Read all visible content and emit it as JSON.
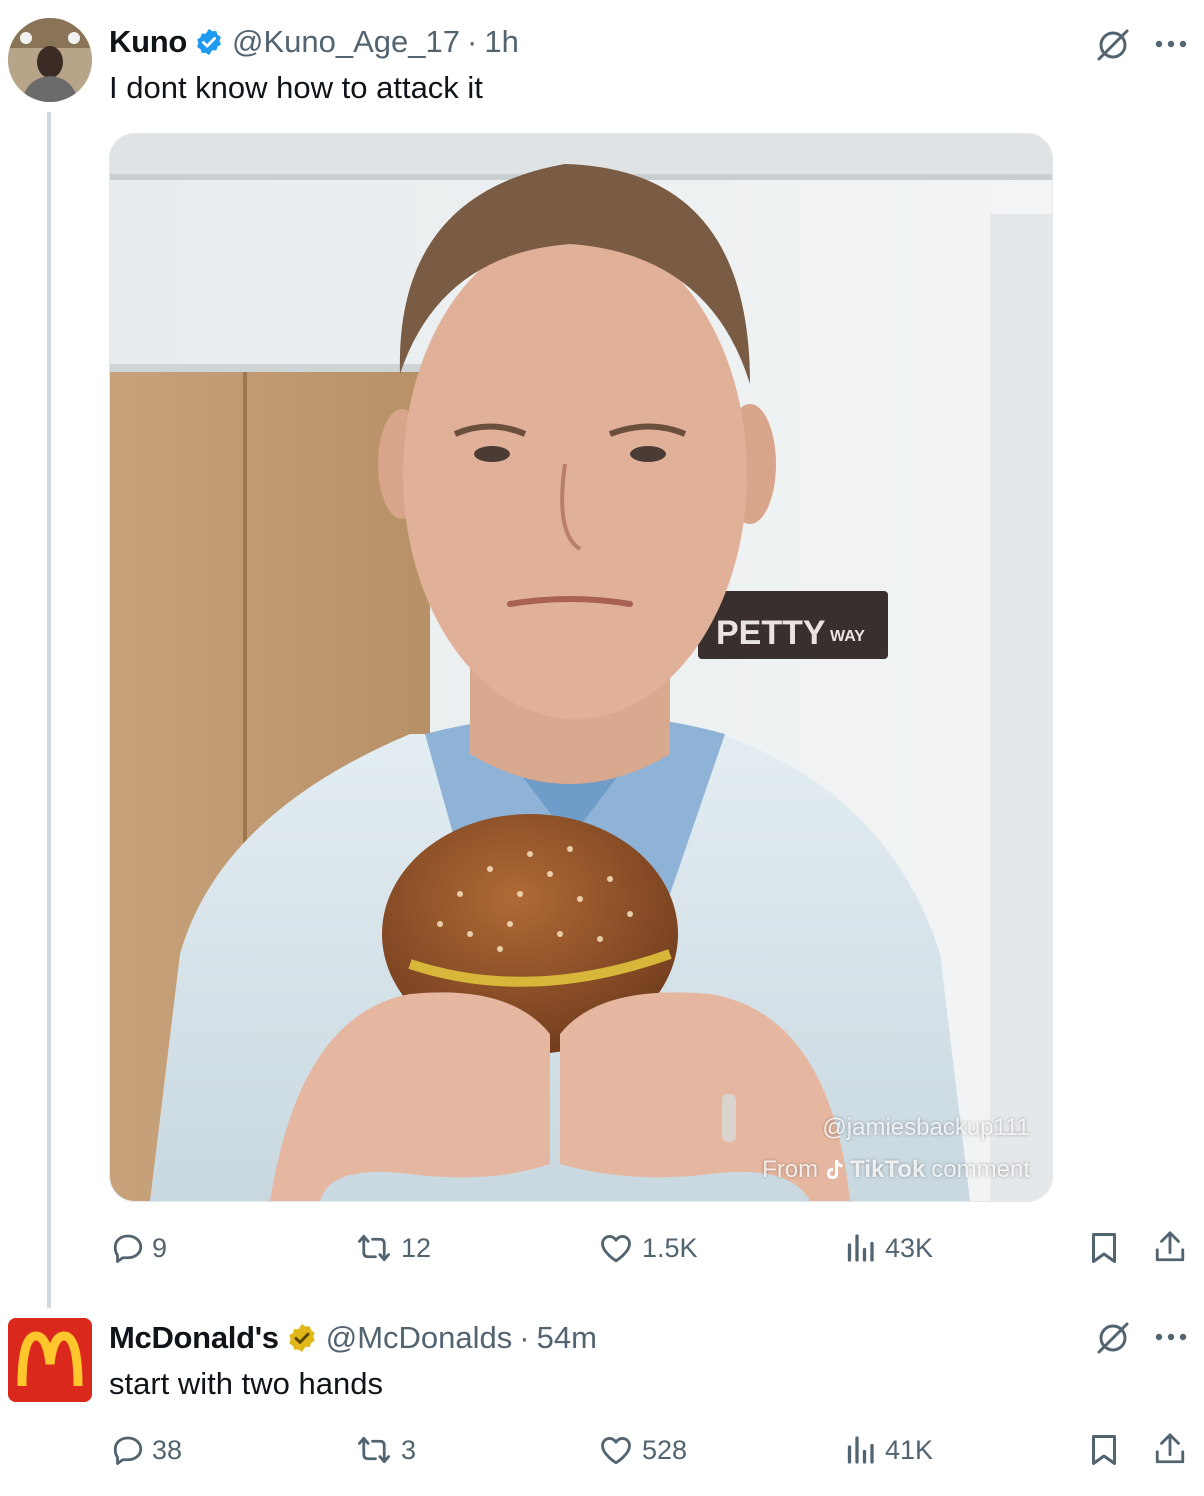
{
  "tweets": [
    {
      "display_name": "Kuno",
      "handle": "@Kuno_Age_17",
      "time": "1h",
      "text": "I dont know how to attack it",
      "verified_badge": "blue-check",
      "media": {
        "sign_text": "PETTY",
        "sign_small": "WAY",
        "watermark_user": "@jamiesbackup111",
        "watermark_from": "From",
        "watermark_brand": "TikTok",
        "watermark_tail": "comment"
      },
      "actions": {
        "replies": "9",
        "reposts": "12",
        "likes": "1.5K",
        "views": "43K"
      }
    },
    {
      "display_name": "McDonald's",
      "handle": "@McDonalds",
      "time": "54m",
      "text": "start with two hands",
      "verified_badge": "gold-check",
      "actions": {
        "replies": "38",
        "reposts": "3",
        "likes": "528",
        "views": "41K"
      }
    }
  ],
  "separator": "·",
  "colors": {
    "verified_blue": "#1d9bf0",
    "verified_gold": "#e2b719",
    "secondary_text": "#536471",
    "mcd_red": "#da291c",
    "mcd_yellow": "#ffc72c"
  },
  "icons": [
    "grok-icon",
    "more-icon",
    "reply-icon",
    "repost-icon",
    "like-icon",
    "views-icon",
    "bookmark-icon",
    "share-icon"
  ]
}
